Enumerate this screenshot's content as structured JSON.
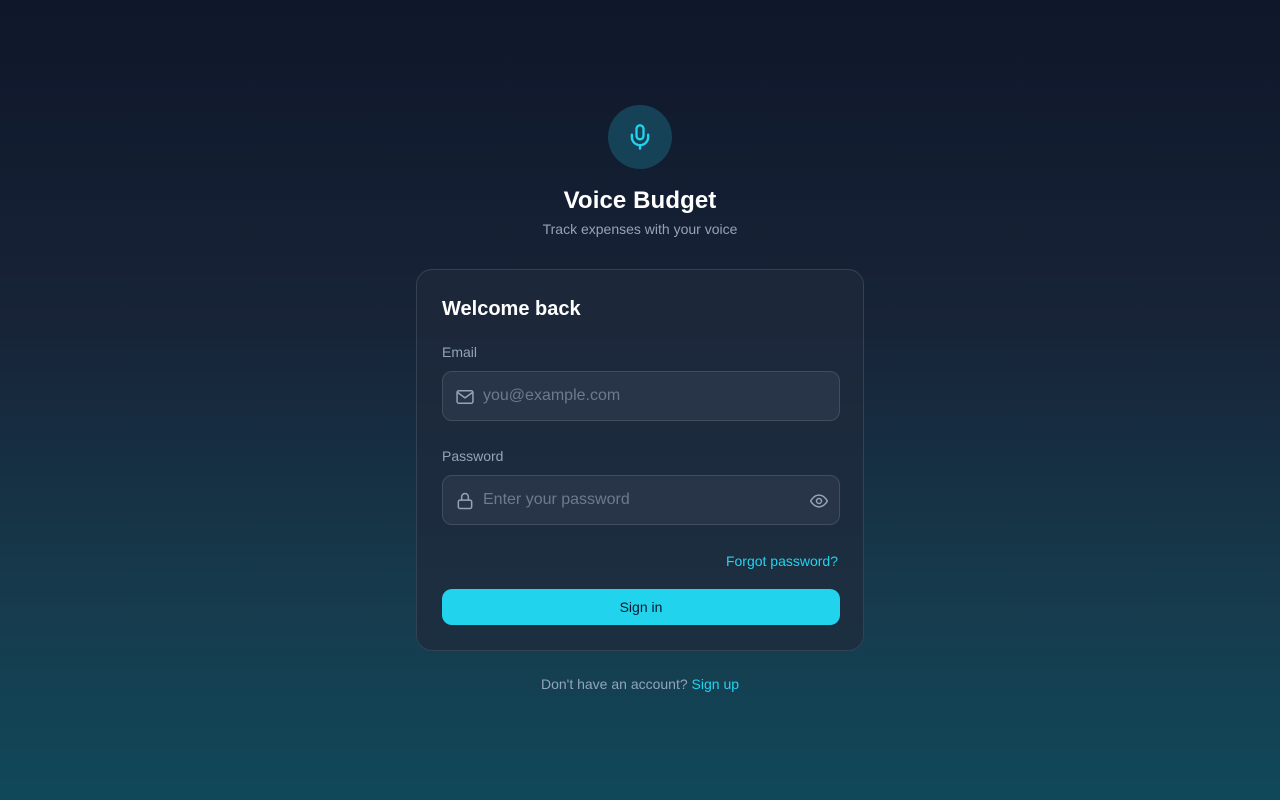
{
  "brand": {
    "title": "Voice Budget",
    "subtitle": "Track expenses with your voice",
    "icon": "microphone-icon"
  },
  "login_card": {
    "title": "Welcome back",
    "email": {
      "label": "Email",
      "value": "",
      "placeholder": "you@example.com",
      "icon": "mail-icon"
    },
    "password": {
      "label": "Password",
      "value": "",
      "placeholder": "Enter your password",
      "icon": "lock-icon",
      "toggle_icon": "eye-icon"
    },
    "forgot_password": "Forgot password?",
    "submit_label": "Sign in"
  },
  "footer": {
    "prompt": "Don't have an account?",
    "signup_label": "Sign up"
  },
  "colors": {
    "accent": "#22d3ee",
    "card_background": "#1e293b",
    "input_background": "#283447",
    "text_muted": "#94a3b8"
  }
}
